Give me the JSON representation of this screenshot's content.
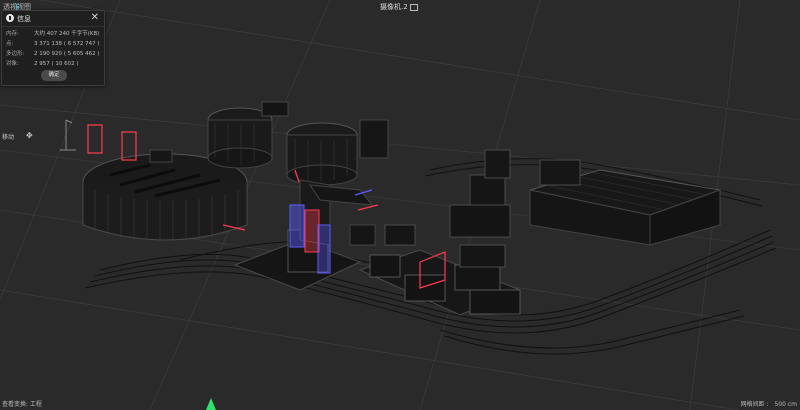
{
  "viewport": {
    "title": "透视视图",
    "camera_label": "摄像机.2"
  },
  "info_panel": {
    "title": "信息",
    "close_symbol": "✕",
    "rows": [
      {
        "label": "内存:",
        "value": "大约 407 240 千字节(KB)"
      },
      {
        "label": "点:",
        "value": "3 371 138 ( 6 572 747 )"
      },
      {
        "label": "多边形:",
        "value": "2 190 920 ( 5 605 462 )"
      },
      {
        "label": "对象:",
        "value": "2 957 ( 10 602 )"
      }
    ],
    "ok_label": "确定"
  },
  "tool": {
    "move_label": "移动",
    "move_icon": "move-arrows-icon"
  },
  "status": {
    "left_text": "查看变换:  工程",
    "grid_label": "网格间距 :",
    "grid_value": "500 cm"
  },
  "colors": {
    "background": "#2a2a2a",
    "highlight_red": "#ff3b4f",
    "highlight_blue": "#5a5cff",
    "axis_green": "#2fe36a",
    "axis_cyan": "#3fd9e8"
  }
}
